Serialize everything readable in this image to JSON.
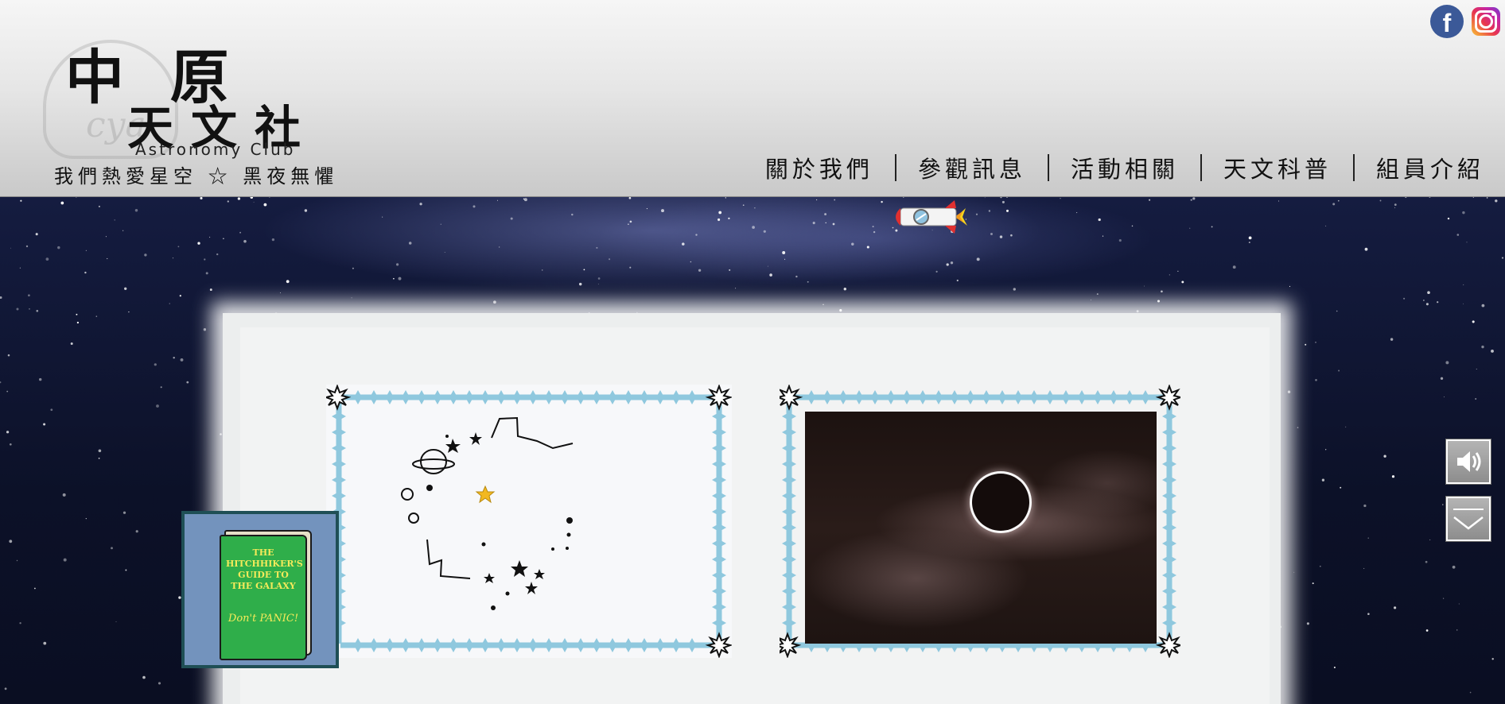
{
  "header": {
    "logo": {
      "line1": "中 原",
      "line2": "天文社",
      "english": "Astronomy Club",
      "badge_text": "cya",
      "slogan": "我們熱愛星空 ☆ 黑夜無懼"
    },
    "nav": [
      {
        "label": "關於我們"
      },
      {
        "label": "參觀訊息"
      },
      {
        "label": "活動相關"
      },
      {
        "label": "天文科普"
      },
      {
        "label": "組員介紹"
      }
    ],
    "social": {
      "facebook_icon": "facebook-icon",
      "instagram_icon": "instagram-icon",
      "facebook_letter": "f"
    }
  },
  "book": {
    "title": "THE HITCHHIKER'S GUIDE TO THE GALAXY",
    "slogan": "Don't PANIC!"
  },
  "side_controls": {
    "sound_icon": "speaker-icon",
    "scroll_icon": "chevron-down-icon"
  },
  "colors": {
    "header_top": "#f6f6f6",
    "header_bottom": "#c9c9c9",
    "night_sky": "#131a3c",
    "frame_border": "#8fc8de",
    "book_cover": "#2fae4a",
    "book_text": "#f4ea5a",
    "book_box": "#7393bd"
  }
}
